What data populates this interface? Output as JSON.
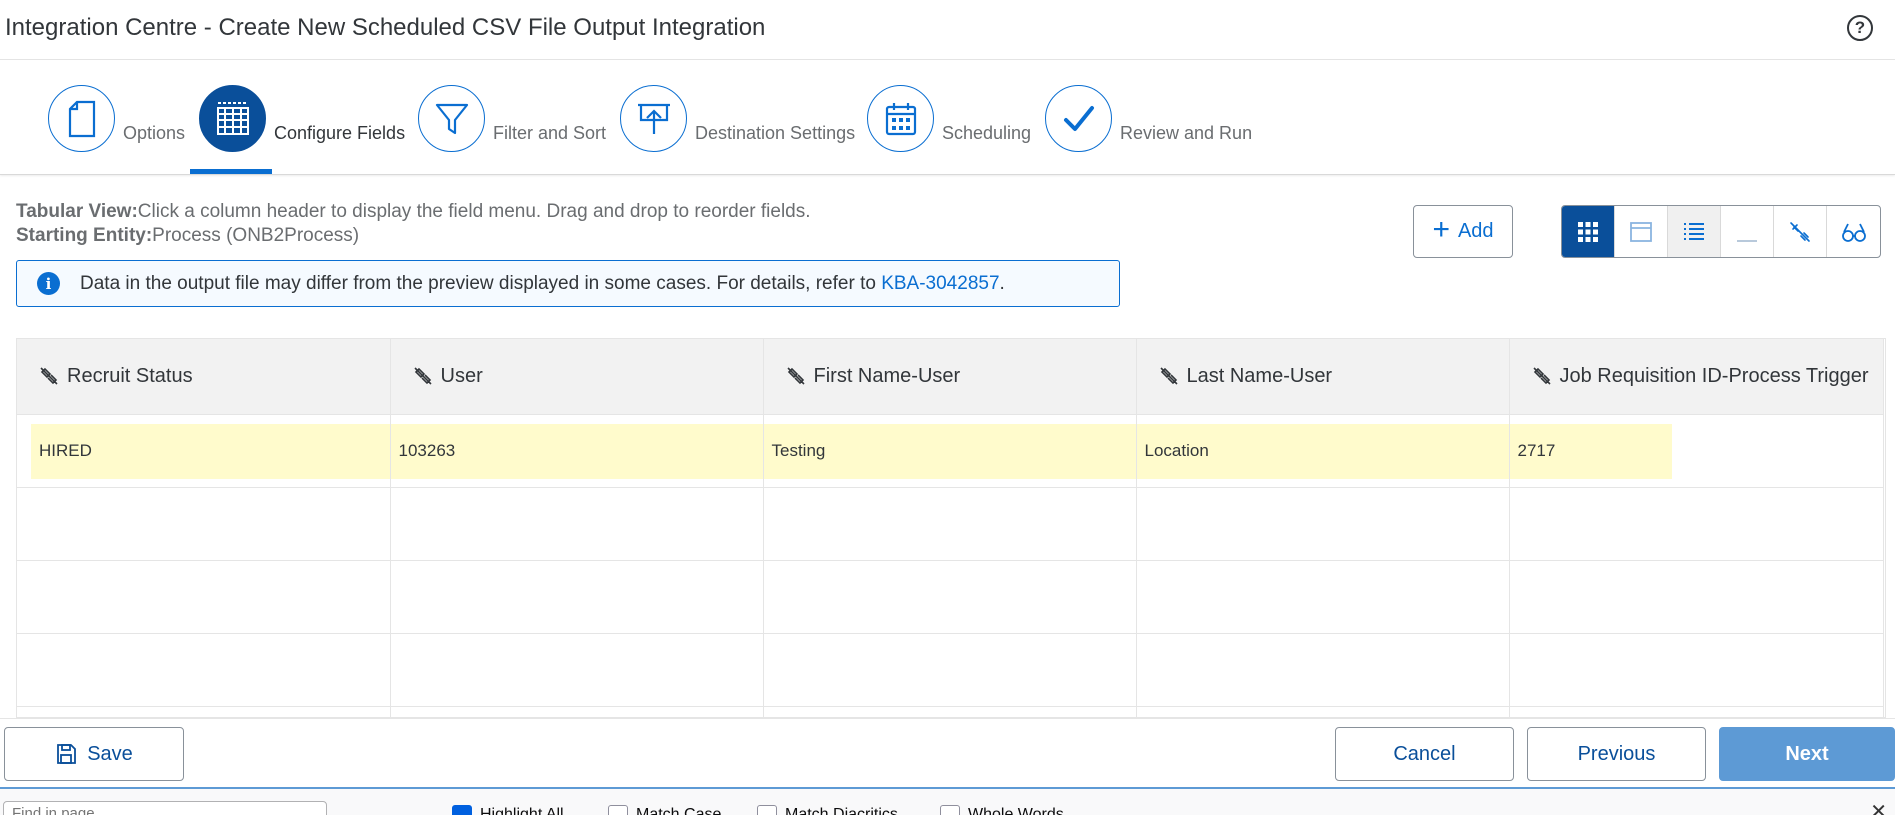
{
  "header": {
    "title": "Integration Centre - Create New Scheduled CSV File Output Integration",
    "help_icon": "?"
  },
  "stepper": {
    "steps": [
      {
        "label": "Options",
        "icon": "document-icon",
        "active": false
      },
      {
        "label": "Configure Fields",
        "icon": "table-grid-icon",
        "active": true
      },
      {
        "label": "Filter and Sort",
        "icon": "filter-icon",
        "active": false
      },
      {
        "label": "Destination Settings",
        "icon": "upload-icon",
        "active": false
      },
      {
        "label": "Scheduling",
        "icon": "calendar-icon",
        "active": false
      },
      {
        "label": "Review and Run",
        "icon": "checkmark-icon",
        "active": false
      }
    ]
  },
  "info": {
    "tabular_label": "Tabular View:",
    "tabular_text": "Click a column header to display the field menu. Drag and drop to reorder fields.",
    "entity_label": "Starting Entity:",
    "entity_text": "Process (ONB2Process)",
    "message_prefix": "Data in the output file may differ from the preview displayed in some cases. For details, refer to ",
    "message_link": "KBA-3042857",
    "message_suffix": "."
  },
  "toolbar": {
    "add_label": "Add",
    "views": [
      "grid-view-icon",
      "window-view-icon",
      "list-view-icon",
      "minimize-icon",
      "link-icon",
      "preview-icon"
    ]
  },
  "table": {
    "columns": [
      "Recruit Status",
      "User",
      "First Name-User",
      "Last Name-User",
      "Job Requisition ID-Process Trigger"
    ],
    "rows": [
      [
        "HIRED",
        "103263",
        "Testing",
        "Location",
        "2717"
      ]
    ]
  },
  "footer": {
    "save_label": "Save",
    "cancel_label": "Cancel",
    "previous_label": "Previous",
    "next_label": "Next"
  },
  "findbar": {
    "placeholder": "Find in page",
    "highlight_label": "Highlight All",
    "match_case_label": "Match Case",
    "diacritics_label": "Match Diacritics",
    "whole_words_label": "Whole Words"
  },
  "colors": {
    "accent": "#0a6ed1",
    "active_step": "#0a4f9a",
    "row_highlight": "#fffbcc",
    "primary_button": "#5d9ad5"
  }
}
